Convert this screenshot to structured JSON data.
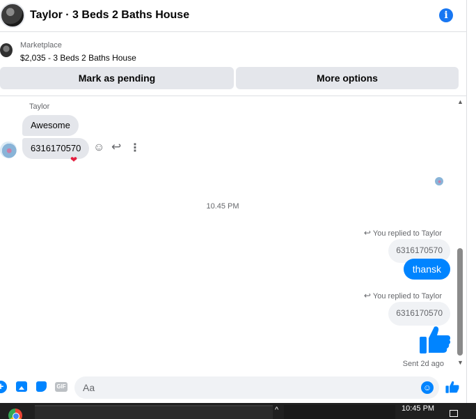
{
  "header": {
    "title": "Taylor · 3 Beds 2 Baths House",
    "info_icon": "info-icon"
  },
  "listing": {
    "source": "Marketplace",
    "price_title": "$2,035 - 3 Beds 2 Baths House",
    "actions": {
      "pending": "Mark as pending",
      "more": "More options"
    }
  },
  "thread": {
    "sender_name": "Taylor",
    "incoming": [
      {
        "text": "Awesome"
      },
      {
        "text": "6316170570",
        "reaction": "❤"
      }
    ],
    "timestamp": "10.45 PM",
    "outgoing": [
      {
        "reply_label": "You replied to Taylor",
        "quoted": "6316170570",
        "text": "thansk"
      },
      {
        "reply_label": "You replied to Taylor",
        "quoted": "6316170570",
        "text": ""
      }
    ],
    "status": "Sent 2d ago"
  },
  "composer": {
    "placeholder": "Aa",
    "gif_label": "GIF"
  },
  "taskbar": {
    "time": "10:45 PM"
  },
  "colors": {
    "accent": "#0084ff",
    "bubble_in": "#e4e6eb",
    "text_secondary": "#65676b"
  }
}
